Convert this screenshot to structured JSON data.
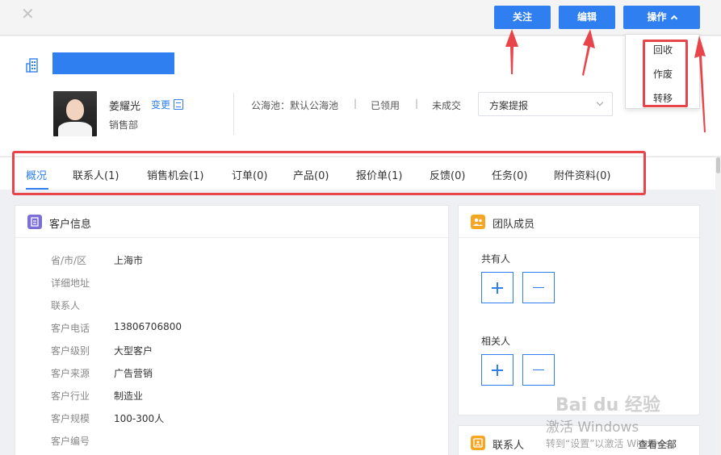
{
  "toolbar": {
    "close_glyph": "✕",
    "follow_label": "关注",
    "edit_label": "编辑",
    "ops_label": "操作"
  },
  "ops_menu": {
    "items": [
      "回收",
      "作废",
      "转移"
    ]
  },
  "customer": {
    "owner_name": "姜耀光",
    "change_label": "变更",
    "department": "销售部",
    "pool": "公海池：默认公海池",
    "claimed": "已领用",
    "deal_status": "未成交",
    "separator": "|",
    "scheme_select": "方案提报"
  },
  "tabs": [
    {
      "label": "概况",
      "active": true
    },
    {
      "label": "联系人(1)"
    },
    {
      "label": "销售机会(1)"
    },
    {
      "label": "订单(0)"
    },
    {
      "label": "产品(0)"
    },
    {
      "label": "报价单(1)"
    },
    {
      "label": "反馈(0)"
    },
    {
      "label": "任务(0)"
    },
    {
      "label": "附件资料(0)"
    }
  ],
  "customer_info": {
    "title": "客户信息",
    "fields": [
      {
        "label": "省/市/区",
        "value": "上海市"
      },
      {
        "label": "详细地址",
        "value": ""
      },
      {
        "label": "联系人",
        "value": ""
      },
      {
        "label": "客户电话",
        "value": "13806706800"
      },
      {
        "label": "客户级别",
        "value": "大型客户"
      },
      {
        "label": "客户来源",
        "value": "广告营销"
      },
      {
        "label": "客户行业",
        "value": "制造业"
      },
      {
        "label": "客户规模",
        "value": "100-300人"
      },
      {
        "label": "客户编号",
        "value": ""
      }
    ]
  },
  "team": {
    "title": "团队成员",
    "owners_label": "共有人",
    "related_label": "相关人"
  },
  "contacts_card": {
    "title": "联系人",
    "view_all": "查看全部"
  },
  "watermark": {
    "baidu": "Bai du 经验",
    "activate_title": "激活 Windows",
    "activate_hint": "转到“设置”以激活 Windows。"
  },
  "colors": {
    "primary": "#2f7ff0",
    "highlight": "#e8454a",
    "info_icon": "#7b6fd6",
    "team_icon": "#f5a623"
  }
}
